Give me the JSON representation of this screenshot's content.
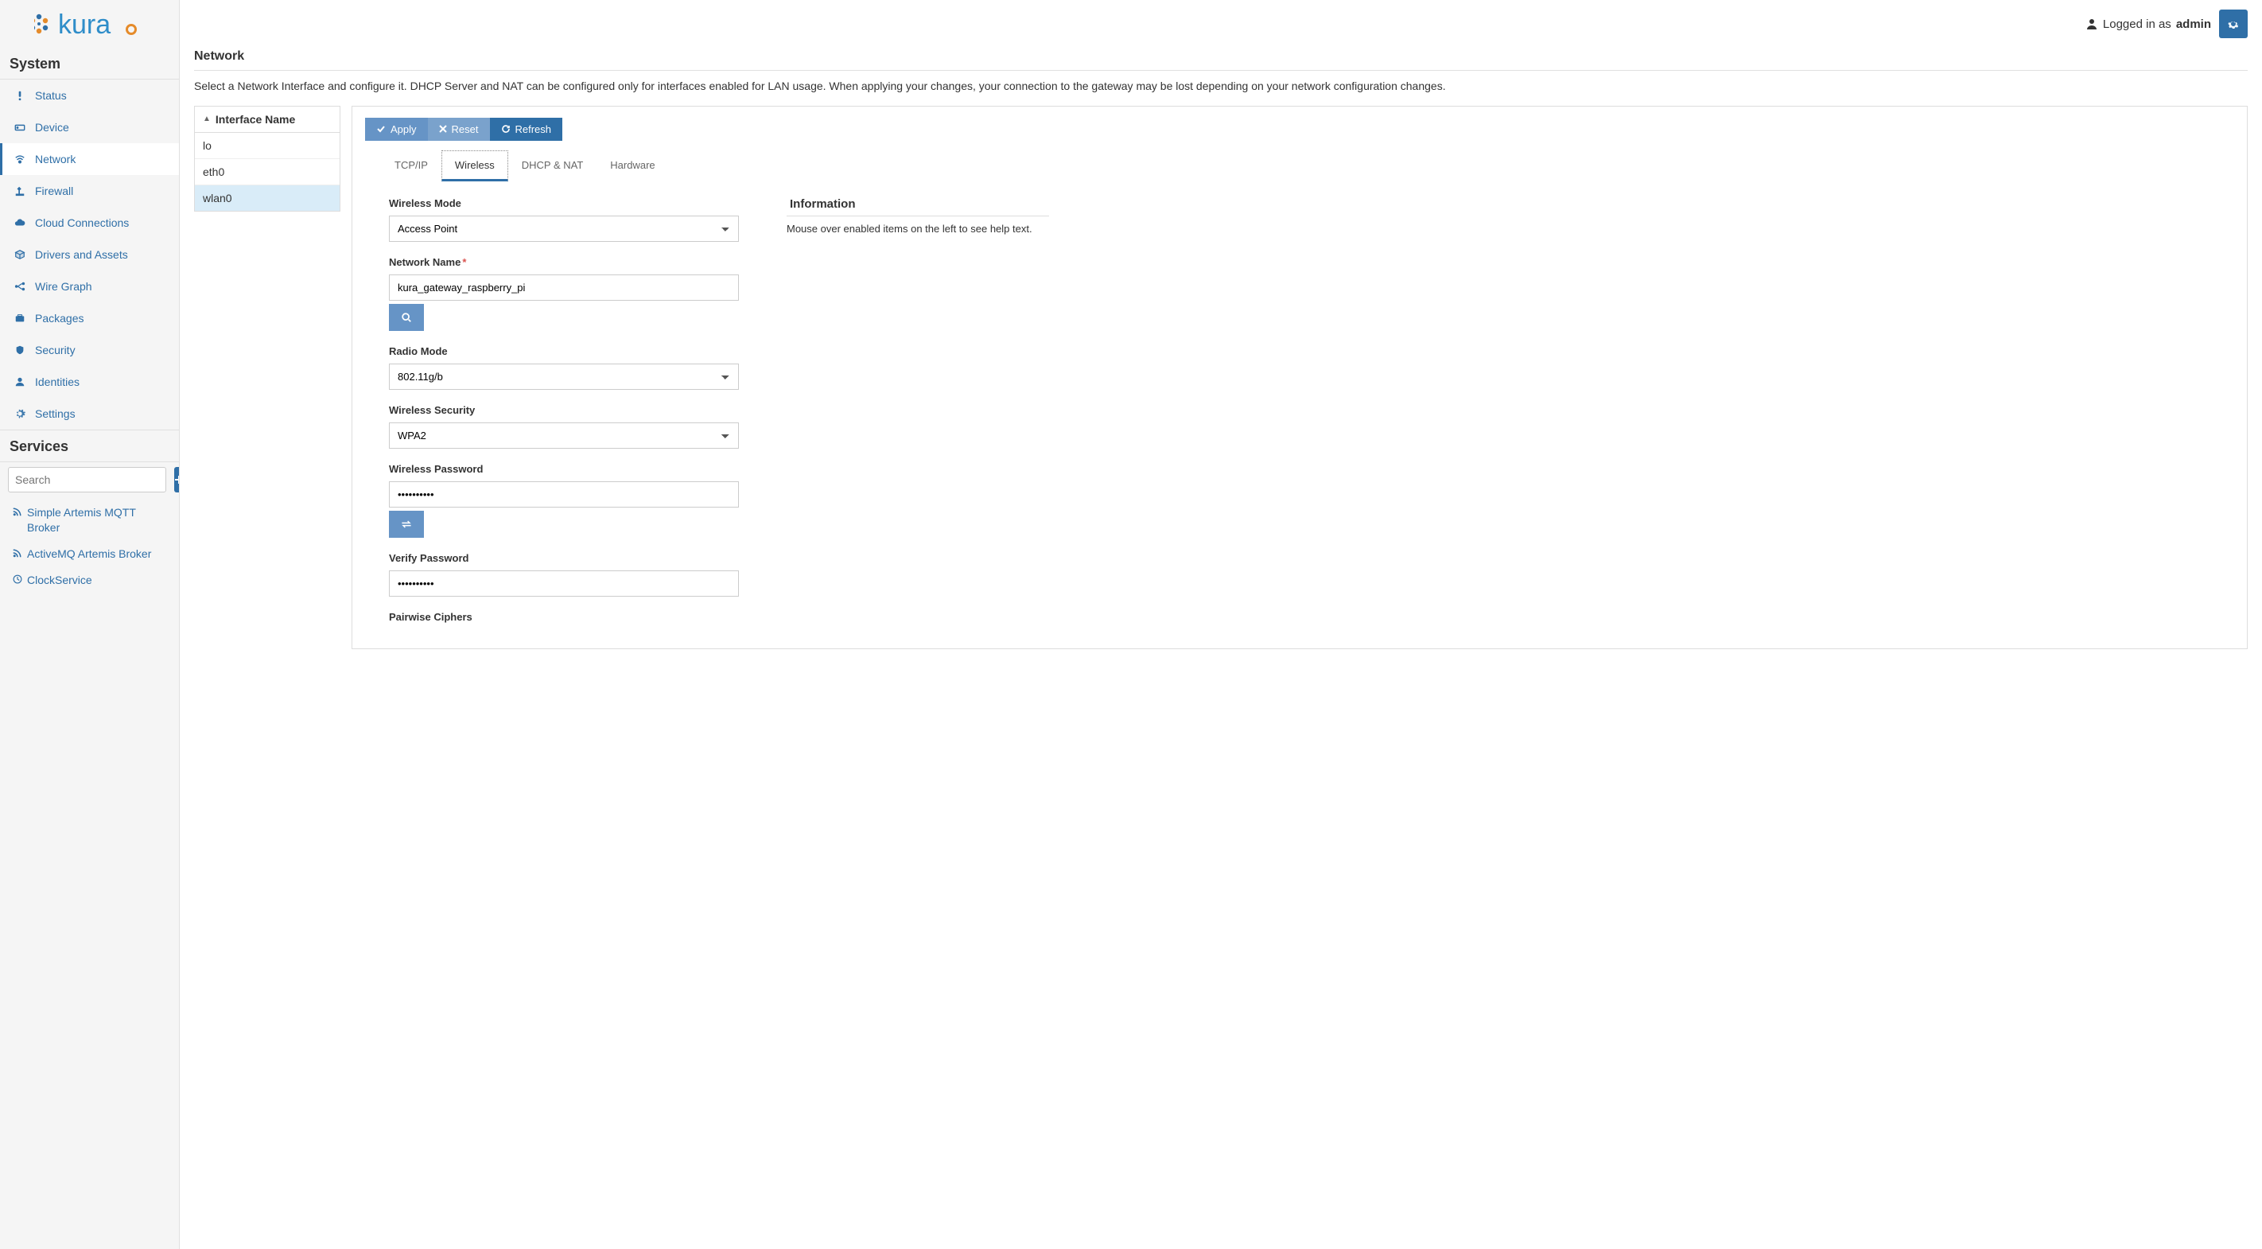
{
  "header": {
    "logged_in_prefix": "Logged in as",
    "username": "admin"
  },
  "sidebar": {
    "system_title": "System",
    "services_title": "Services",
    "search_placeholder": "Search",
    "nav": [
      {
        "icon": "exclamation",
        "label": "Status"
      },
      {
        "icon": "hdd",
        "label": "Device"
      },
      {
        "icon": "wifi",
        "label": "Network",
        "active": true
      },
      {
        "icon": "firewall",
        "label": "Firewall"
      },
      {
        "icon": "cloud",
        "label": "Cloud Connections"
      },
      {
        "icon": "cube",
        "label": "Drivers and Assets"
      },
      {
        "icon": "graph",
        "label": "Wire Graph"
      },
      {
        "icon": "briefcase",
        "label": "Packages"
      },
      {
        "icon": "shield",
        "label": "Security"
      },
      {
        "icon": "user",
        "label": "Identities"
      },
      {
        "icon": "gear",
        "label": "Settings"
      }
    ],
    "services": [
      {
        "icon": "rss",
        "label": "Simple Artemis MQTT Broker"
      },
      {
        "icon": "rss",
        "label": "ActiveMQ Artemis Broker"
      },
      {
        "icon": "clock",
        "label": "ClockService"
      }
    ]
  },
  "page": {
    "title": "Network",
    "description": "Select a Network Interface and configure it. DHCP Server and NAT can be configured only for interfaces enabled for LAN usage. When applying your changes, your connection to the gateway may be lost depending on your network configuration changes."
  },
  "interfaces": {
    "header": "Interface Name",
    "rows": [
      "lo",
      "eth0",
      "wlan0"
    ],
    "selected": "wlan0"
  },
  "toolbar": {
    "apply": "Apply",
    "reset": "Reset",
    "refresh": "Refresh"
  },
  "tabs": [
    "TCP/IP",
    "Wireless",
    "DHCP & NAT",
    "Hardware"
  ],
  "active_tab": "Wireless",
  "info": {
    "title": "Information",
    "help": "Mouse over enabled items on the left to see help text."
  },
  "form": {
    "wireless_mode": {
      "label": "Wireless Mode",
      "value": "Access Point"
    },
    "network_name": {
      "label": "Network Name",
      "value": "kura_gateway_raspberry_pi",
      "required": true
    },
    "radio_mode": {
      "label": "Radio Mode",
      "value": "802.11g/b"
    },
    "wireless_security": {
      "label": "Wireless Security",
      "value": "WPA2"
    },
    "wireless_password": {
      "label": "Wireless Password",
      "value": "••••••••••"
    },
    "verify_password": {
      "label": "Verify Password",
      "value": "••••••••••"
    },
    "pairwise_ciphers": {
      "label": "Pairwise Ciphers"
    }
  }
}
